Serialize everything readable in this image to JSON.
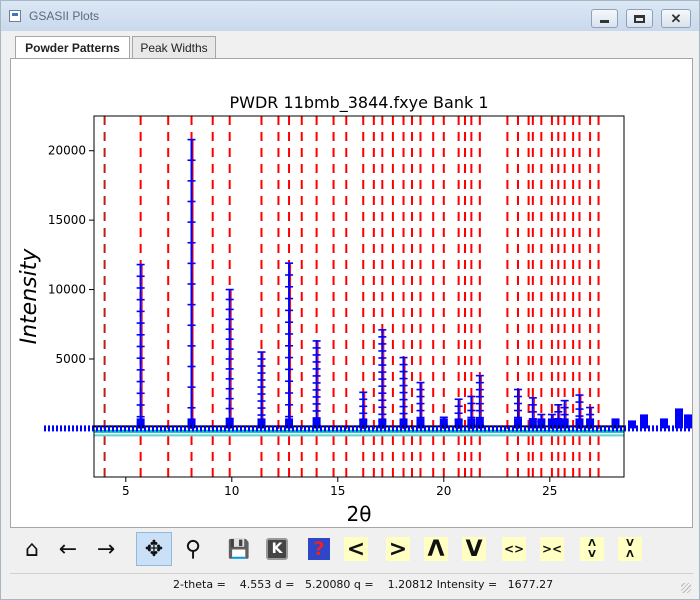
{
  "window": {
    "title": "GSASII Plots",
    "min_icon": "minimize-icon",
    "max_icon": "maximize-icon",
    "close_icon": "close-icon"
  },
  "tabs": [
    {
      "label": "Powder Patterns",
      "active": true
    },
    {
      "label": "Peak Widths",
      "active": false
    }
  ],
  "toolbar": {
    "tools": [
      {
        "name": "home-icon",
        "glyph": "⌂"
      },
      {
        "name": "back-arrow-icon",
        "glyph": "←"
      },
      {
        "name": "forward-arrow-icon",
        "glyph": "→"
      },
      {
        "name": "pan-icon",
        "glyph": "✥",
        "active": true
      },
      {
        "name": "zoom-icon",
        "glyph": "⚲"
      },
      {
        "name": "save-icon",
        "glyph": "💾"
      },
      {
        "name": "k-key-icon",
        "glyph": "K"
      },
      {
        "name": "help-icon",
        "glyph": "?"
      },
      {
        "name": "shift-left-icon",
        "glyph": "<"
      },
      {
        "name": "shift-right-icon",
        "glyph": ">"
      },
      {
        "name": "shift-up-icon",
        "glyph": "Λ"
      },
      {
        "name": "shift-down-icon",
        "glyph": "V"
      },
      {
        "name": "expand-x-icon",
        "glyph": "<>"
      },
      {
        "name": "contract-x-icon",
        "glyph": "><"
      },
      {
        "name": "expand-y-icon",
        "glyph": "Λ/V"
      },
      {
        "name": "contract-y-icon",
        "glyph": "V/Λ"
      }
    ]
  },
  "status": {
    "text": "2-theta =    4.553 d =   5.20080 q =    1.20812 Intensity =   1677.27"
  },
  "colors": {
    "observed": "#0000ff",
    "calculated": "#ff0000",
    "background": "#00bfbf",
    "reflection_tick": "#ff0000",
    "reflection_tick_alt": "#b22222",
    "axes": "#000000",
    "active_tool": "#c9e0f7"
  },
  "chart_data": {
    "type": "line",
    "title": "PWDR 11bmb_3844.fxye Bank 1",
    "xlabel": "2θ",
    "ylabel": "Intensity",
    "xlim": [
      3.5,
      28.5
    ],
    "ylim": [
      -3500,
      22500
    ],
    "xticks": [
      5,
      10,
      15,
      20,
      25
    ],
    "yticks": [
      5000,
      10000,
      15000,
      20000
    ],
    "grid": false,
    "baseline": 0,
    "series": [
      {
        "role": "observed",
        "peaks": [
          {
            "x": 5.7,
            "y": 11800
          },
          {
            "x": 8.1,
            "y": 20800
          },
          {
            "x": 9.9,
            "y": 10000
          },
          {
            "x": 11.4,
            "y": 5500
          },
          {
            "x": 12.7,
            "y": 11900
          },
          {
            "x": 14.0,
            "y": 6300
          },
          {
            "x": 16.2,
            "y": 2600
          },
          {
            "x": 17.1,
            "y": 7100
          },
          {
            "x": 18.1,
            "y": 5100
          },
          {
            "x": 18.9,
            "y": 3300
          },
          {
            "x": 20.0,
            "y": 800
          },
          {
            "x": 20.7,
            "y": 2100
          },
          {
            "x": 21.3,
            "y": 2300
          },
          {
            "x": 21.7,
            "y": 3800
          },
          {
            "x": 23.5,
            "y": 2800
          },
          {
            "x": 24.2,
            "y": 2200
          },
          {
            "x": 24.6,
            "y": 1000
          },
          {
            "x": 25.1,
            "y": 1000
          },
          {
            "x": 25.4,
            "y": 1700
          },
          {
            "x": 25.7,
            "y": 2000
          },
          {
            "x": 26.4,
            "y": 2400
          },
          {
            "x": 26.9,
            "y": 1500
          },
          {
            "x": 28.1,
            "y": 600
          }
        ]
      }
    ],
    "reflections": [
      4.0,
      5.7,
      7.0,
      8.1,
      9.1,
      9.9,
      11.4,
      12.2,
      12.7,
      13.3,
      14.0,
      14.8,
      15.4,
      16.2,
      16.7,
      17.1,
      17.6,
      18.1,
      18.5,
      18.9,
      19.5,
      20.0,
      20.7,
      21.0,
      21.3,
      21.7,
      23.0,
      23.5,
      24.0,
      24.2,
      24.6,
      25.1,
      25.4,
      25.7,
      26.1,
      26.4,
      26.9,
      27.3
    ]
  }
}
